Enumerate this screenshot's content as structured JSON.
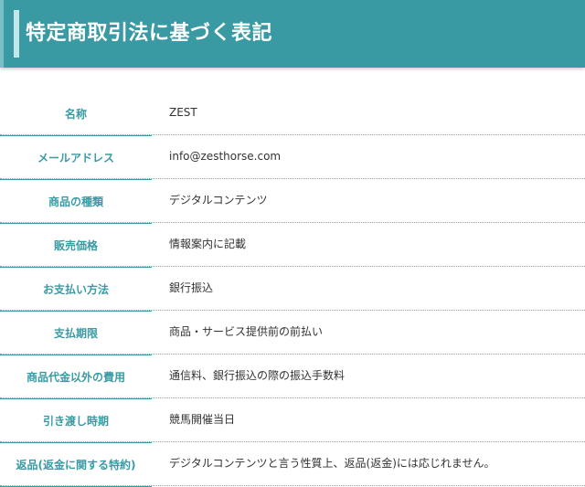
{
  "page": {
    "title": "特定商取引法に基づく表記"
  },
  "table": {
    "rows": [
      {
        "label": "名称",
        "value": "ZEST"
      },
      {
        "label": "メールアドレス",
        "value": "info@zesthorse.com"
      },
      {
        "label": "商品の種類",
        "value": "デジタルコンテンツ"
      },
      {
        "label": "販売価格",
        "value": "情報案内に記載"
      },
      {
        "label": "お支払い方法",
        "value": "銀行振込"
      },
      {
        "label": "支払期限",
        "value": "商品・サービス提供前の前払い"
      },
      {
        "label": "商品代金以外の費用",
        "value": "通信料、銀行振込の際の振込手数料"
      },
      {
        "label": "引き渡し時期",
        "value": "競馬開催当日"
      },
      {
        "label": "返品(返金に関する特約)",
        "value": "デジタルコンテンツと言う性質上、返品(返金)には応じれません。"
      }
    ]
  },
  "colors": {
    "accent": "#3a9aa3",
    "accent_light": "#c5e7ea",
    "text": "#333333"
  }
}
